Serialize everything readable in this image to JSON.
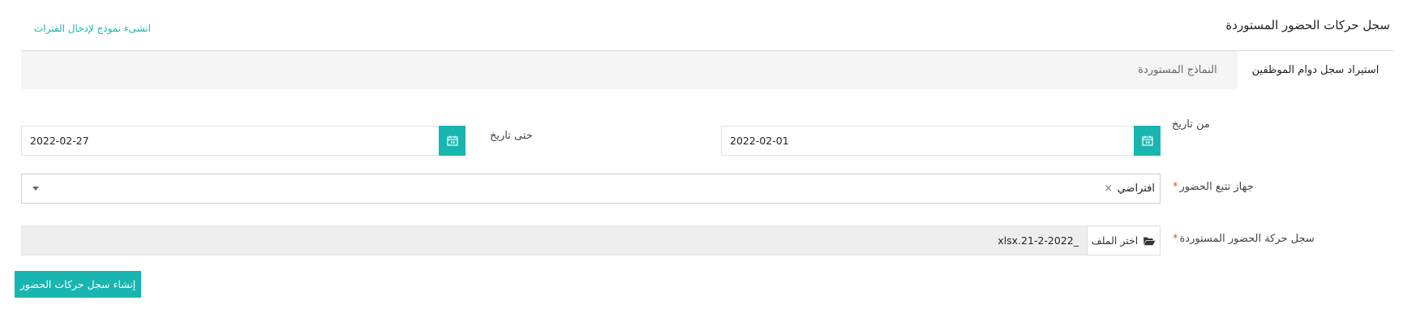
{
  "header": {
    "title": "سجل حركات الحضور المستوردة",
    "create_template_link": "انشىء نموذج لإدخال الفترات"
  },
  "tabs": [
    {
      "label": "استيراد سجل دوام الموظفين",
      "active": true
    },
    {
      "label": "النماذج المستوردة",
      "active": false
    }
  ],
  "form": {
    "from_date": {
      "label": "من تاريخ",
      "value": "2022-02-01",
      "icon": "calendar-icon"
    },
    "to_date": {
      "label": "حتى تاريخ",
      "value": "2022-02-27",
      "icon": "calendar-icon"
    },
    "device": {
      "label": "جهاز تتبع الحضور",
      "required_mark": "*",
      "value": "افتراضي",
      "clear_symbol": "×",
      "icon": "chevron-down-icon"
    },
    "file": {
      "label": "سجل حركة الحضور المستوردة",
      "required_mark": "*",
      "button_label": "اختر الملف",
      "button_icon": "folder-open-icon",
      "file_name": "xlsx.21-2-2022_"
    }
  },
  "actions": {
    "submit_label": "إنشاء سجل حركات الحضور"
  },
  "colors": {
    "accent": "#19b5b0",
    "required": "#e74c3c",
    "tab_bar_bg": "#f5f5f5",
    "file_field_bg": "#eeeeee"
  }
}
